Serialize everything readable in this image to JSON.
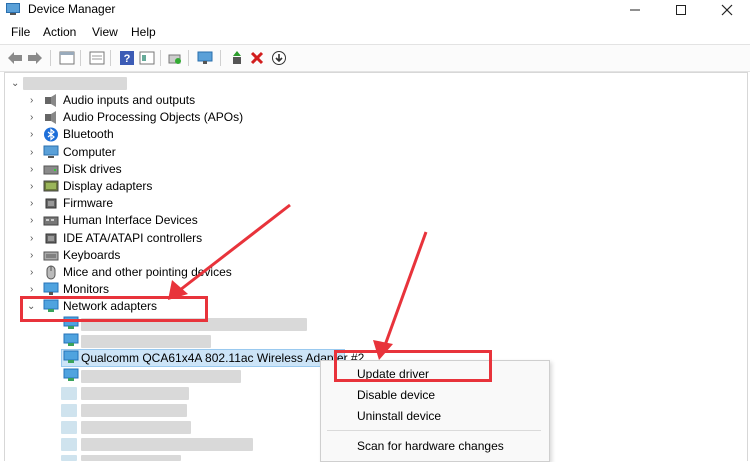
{
  "window": {
    "title": "Device Manager",
    "controls": [
      "minimize",
      "maximize",
      "close"
    ]
  },
  "menu": [
    "File",
    "Action",
    "View",
    "Help"
  ],
  "toolbar_icons": [
    "back-arrow-icon",
    "forward-arrow-icon",
    "properties-icon",
    "hidden-devices-icon",
    "help-icon",
    "view-icon",
    "scan-icon",
    "monitor-icon",
    "update-driver-icon",
    "uninstall-icon",
    "disable-icon"
  ],
  "tree": {
    "categories": [
      {
        "label": "Audio inputs and outputs",
        "icon": "speaker-icon"
      },
      {
        "label": "Audio Processing Objects (APOs)",
        "icon": "speaker-icon"
      },
      {
        "label": "Bluetooth",
        "icon": "bluetooth-icon"
      },
      {
        "label": "Computer",
        "icon": "computer-icon"
      },
      {
        "label": "Disk drives",
        "icon": "disk-icon"
      },
      {
        "label": "Display adapters",
        "icon": "display-icon"
      },
      {
        "label": "Firmware",
        "icon": "chip-icon"
      },
      {
        "label": "Human Interface Devices",
        "icon": "hid-icon"
      },
      {
        "label": "IDE ATA/ATAPI controllers",
        "icon": "chip-icon"
      },
      {
        "label": "Keyboards",
        "icon": "keyboard-icon"
      },
      {
        "label": "Mice and other pointing devices",
        "icon": "mouse-icon"
      },
      {
        "label": "Monitors",
        "icon": "monitor-icon"
      },
      {
        "label": "Network adapters",
        "icon": "network-icon"
      }
    ],
    "selected_adapter": "Qualcomm QCA61x4A 802.11ac Wireless Adapter #2"
  },
  "context_menu": {
    "items": [
      "Update driver",
      "Disable device",
      "Uninstall device",
      "Scan for hardware changes"
    ]
  },
  "colors": {
    "selection": "#cce4f7",
    "highlight": "#e8333b"
  }
}
